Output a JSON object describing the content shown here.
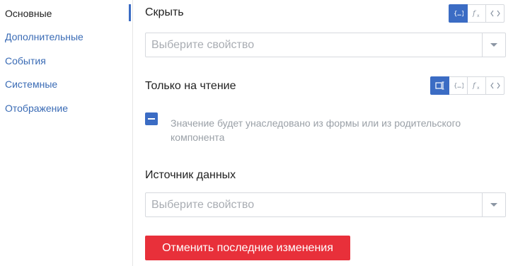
{
  "sidebar": {
    "items": [
      {
        "label": "Основные",
        "active": true
      },
      {
        "label": "Дополнительные",
        "active": false
      },
      {
        "label": "События",
        "active": false
      },
      {
        "label": "Системные",
        "active": false
      },
      {
        "label": "Отображение",
        "active": false
      }
    ]
  },
  "hide": {
    "label": "Скрыть",
    "select_placeholder": "Выберите свойство",
    "toolbar": {
      "active": "binding-icon",
      "icons": [
        "binding-icon",
        "formula-icon",
        "code-icon"
      ]
    }
  },
  "readonly": {
    "label": "Только на чтение",
    "toolbar": {
      "active": "toggle-icon",
      "icons": [
        "toggle-icon",
        "binding-icon",
        "formula-icon",
        "code-icon"
      ]
    },
    "checkbox_state": "indeterminate",
    "hint": "Значение будет унаследовано из формы или из родительского компонента"
  },
  "datasource": {
    "label": "Источник данных",
    "select_placeholder": "Выберите свойство"
  },
  "reset_button": "Отменить последние изменения",
  "colors": {
    "accent": "#3b6cc4",
    "danger": "#e8303a",
    "nav_link": "#3a6bb5"
  }
}
